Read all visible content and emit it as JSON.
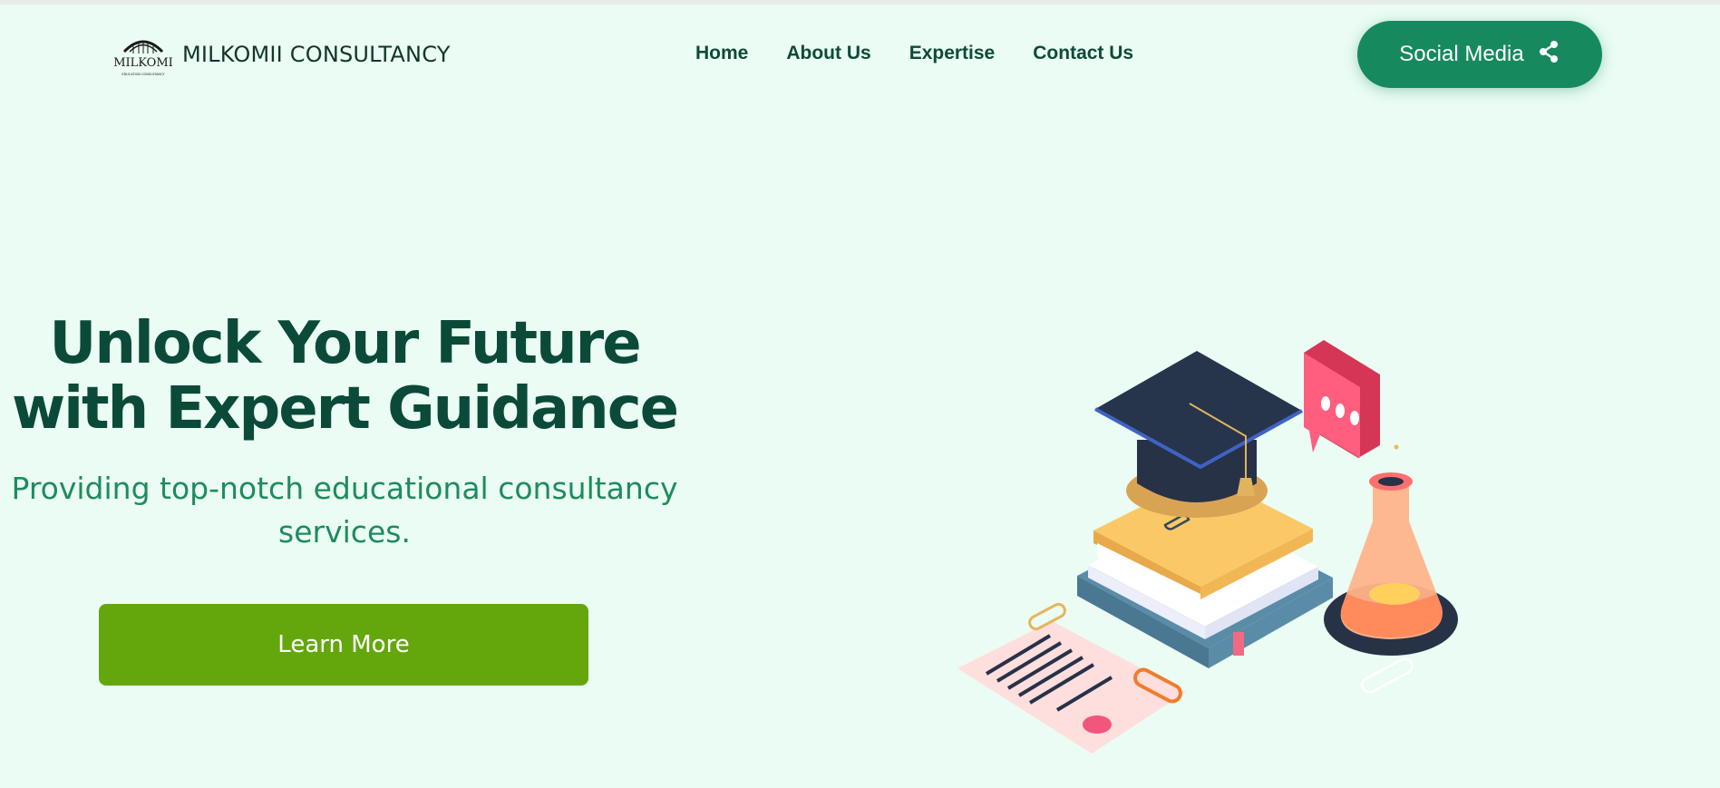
{
  "header": {
    "logo_mark_text": "MILKOMI",
    "logo_mark_subtext": "EDUCATION CONSULTANCY",
    "brand_name": "MILKOMII CONSULTANCY",
    "nav": [
      {
        "label": "Home"
      },
      {
        "label": "About Us"
      },
      {
        "label": "Expertise"
      },
      {
        "label": "Contact Us"
      }
    ],
    "social_button_label": "Social Media",
    "social_icon": "share-icon"
  },
  "hero": {
    "title_line1": "Unlock Your Future",
    "title_line2": "with Expert Guidance",
    "subtitle_line1": "Providing top-notch educational consultancy",
    "subtitle_line2": "services.",
    "cta_label": "Learn More"
  },
  "colors": {
    "background": "#eafcf3",
    "brand_green": "#168a5e",
    "title_green": "#0b4a38",
    "cta_green": "#64a70c"
  }
}
